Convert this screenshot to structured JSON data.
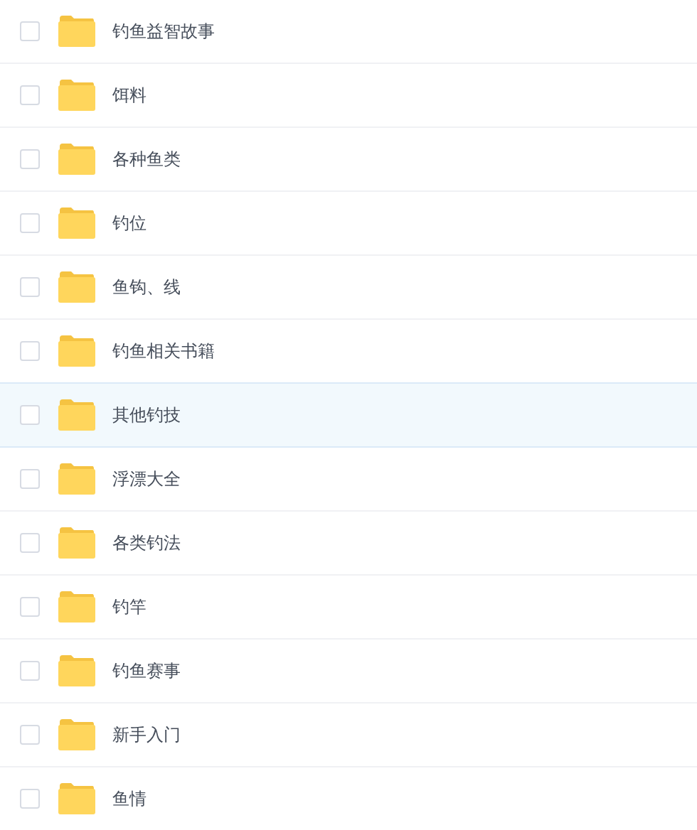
{
  "folders": [
    {
      "name": "钓鱼益智故事",
      "checked": false,
      "selected": false
    },
    {
      "name": "饵料",
      "checked": false,
      "selected": false
    },
    {
      "name": "各种鱼类",
      "checked": false,
      "selected": false
    },
    {
      "name": "钓位",
      "checked": false,
      "selected": false
    },
    {
      "name": "鱼钩、线",
      "checked": false,
      "selected": false
    },
    {
      "name": "钓鱼相关书籍",
      "checked": false,
      "selected": false
    },
    {
      "name": "其他钓技",
      "checked": false,
      "selected": true
    },
    {
      "name": "浮漂大全",
      "checked": false,
      "selected": false
    },
    {
      "name": "各类钓法",
      "checked": false,
      "selected": false
    },
    {
      "name": "钓竿",
      "checked": false,
      "selected": false
    },
    {
      "name": "钓鱼赛事",
      "checked": false,
      "selected": false
    },
    {
      "name": "新手入门",
      "checked": false,
      "selected": false
    },
    {
      "name": "鱼情",
      "checked": false,
      "selected": false
    }
  ]
}
